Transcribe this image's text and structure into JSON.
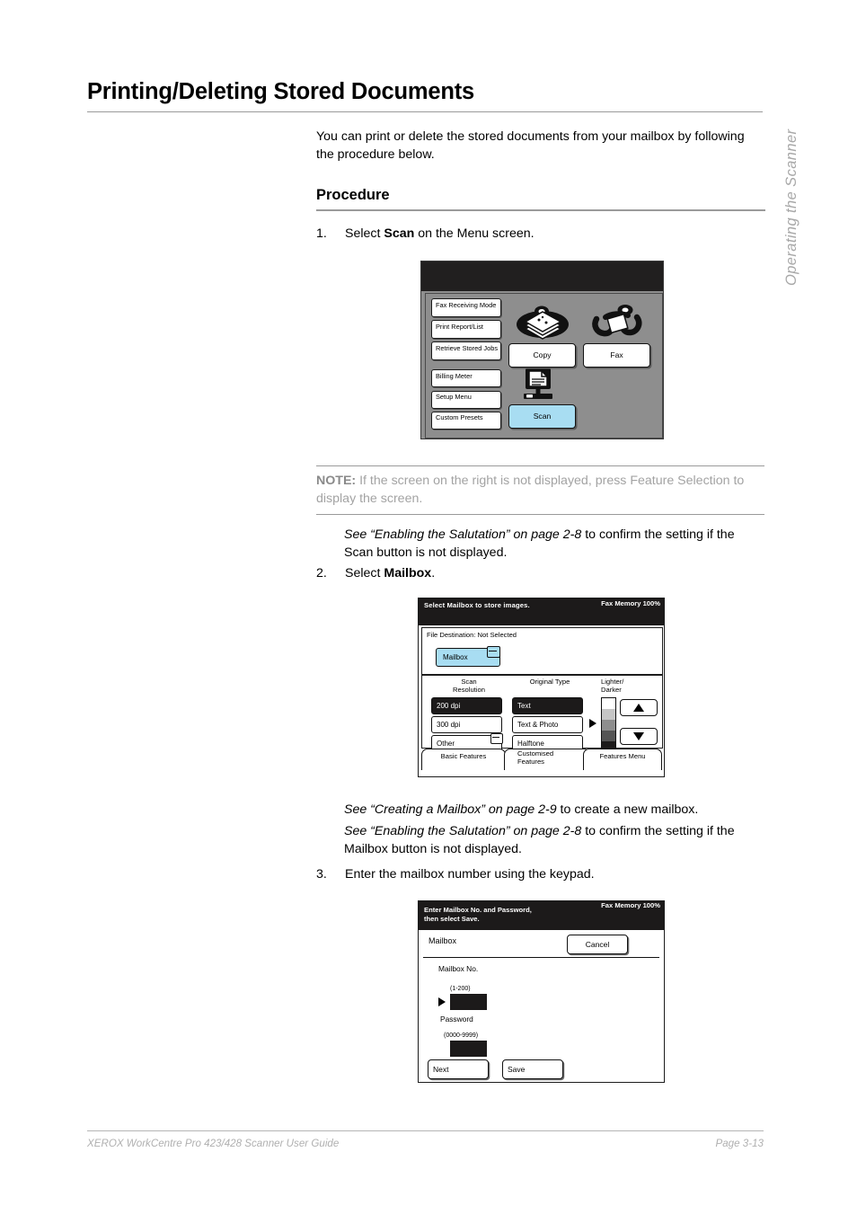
{
  "side_tab": "Operating the Scanner",
  "title": "Printing/Deleting Stored Documents",
  "intro": "You can print or delete the stored documents from your mailbox by following the procedure below.",
  "sub_head": "Procedure",
  "steps": {
    "s1_num": "1.",
    "s1_text_a": "Select ",
    "s1_bold": "Scan",
    "s1_text_b": " on the Menu screen.",
    "s2_num": "2.",
    "s2_text_a": "Select ",
    "s2_bold": "Mailbox",
    "s2_text_b": ".",
    "s3_num": "3.",
    "s3_text": "Enter the mailbox number using the keypad."
  },
  "note": {
    "label": "NOTE:",
    "body": " If the screen on the right is not displayed, press Feature Selection to display the screen."
  },
  "cross_refs": {
    "ref1_italic": "See “Enabling the Salutation” on page 2-8",
    "ref1_rest": " to confirm the setting if the Scan button is not displayed.",
    "ref2_italic": "See “Creating a Mailbox” on page 2-9",
    "ref2_rest": " to create a new mailbox.",
    "ref3_italic": "See “Enabling the Salutation” on page 2-8",
    "ref3_rest": " to confirm the setting if the Mailbox button is not displayed."
  },
  "footer": {
    "left": "XEROX WorkCentre Pro 423/428 Scanner User Guide",
    "right": "Page 3-13"
  },
  "screen_menu": {
    "left_buttons": [
      "Fax Receiving Mode",
      "Print Report/List",
      "Retrieve Stored Jobs",
      "Billing Meter",
      "Setup Menu",
      "Custom Presets"
    ],
    "copy_label": "Copy",
    "fax_label": "Fax",
    "scan_label": "Scan",
    "scan_highlight_color": "#a8ddf2",
    "background_color": "#8e8e8e"
  },
  "screen_mailbox": {
    "header_left": "Select Mailbox to store images.",
    "header_right": "Fax Memory 100%",
    "destination_label": "File Destination: Not Selected",
    "mailbox_button": "Mailbox",
    "mailbox_button_color": "#a8ddf2",
    "group_scan_resolution": "Scan\nResolution",
    "group_scan_resolution_l1": "Scan",
    "group_scan_resolution_l2": "Resolution",
    "group_original_type": "Original Type",
    "group_lighter_darker_l1": "Lighter/",
    "group_lighter_darker_l2": "Darker",
    "resolution_options": [
      "200 dpi",
      "300 dpi",
      "Other"
    ],
    "resolution_selected": "200 dpi",
    "original_type_options": [
      "Text",
      "Text & Photo",
      "Halftone"
    ],
    "original_type_selected": "Text",
    "density_steps": [
      "#ffffff",
      "#c6c6c6",
      "#8e8e8e",
      "#545454",
      "#1c1a1a"
    ],
    "tabs": [
      "Basic Features",
      "Customised Features",
      "Features Menu"
    ],
    "tab_customised_l1": "Customised",
    "tab_customised_l2": "Features"
  },
  "screen_entry": {
    "header_l1": "Enter Mailbox No. and Password,",
    "header_l2": "then select Save.",
    "header_right": "Fax Memory 100%",
    "row_label": "Mailbox",
    "cancel_label": "Cancel",
    "mailbox_no_label": "Mailbox No.",
    "mailbox_no_range": "(1-200)",
    "mailbox_no_value": "",
    "password_label": "Password",
    "password_range": "(0000-9999)",
    "password_value": "",
    "next_label": "Next",
    "save_label": "Save"
  }
}
